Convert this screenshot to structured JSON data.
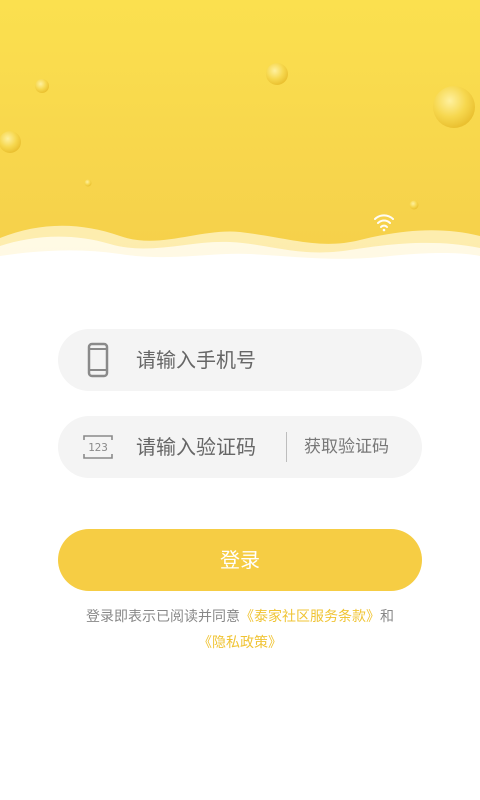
{
  "theme": {
    "accent": "#f6cd44",
    "link": "#f0c435",
    "header_top": "#fbe04f",
    "header_bottom": "#f5cf4a",
    "field_bg": "#f4f4f4"
  },
  "header": {
    "status_icon": "wifi-icon"
  },
  "form": {
    "phone": {
      "icon": "phone-icon",
      "placeholder": "请输入手机号",
      "value": ""
    },
    "code": {
      "icon": "keypad-123-icon",
      "icon_text": "123",
      "placeholder": "请输入验证码",
      "value": "",
      "get_code_label": "获取验证码"
    },
    "login_label": "登录"
  },
  "agreement": {
    "prefix": "登录即表示已阅读并同意",
    "terms_link": "《泰家社区服务条款》",
    "conjunction": "和",
    "privacy_link": "《隐私政策》"
  }
}
